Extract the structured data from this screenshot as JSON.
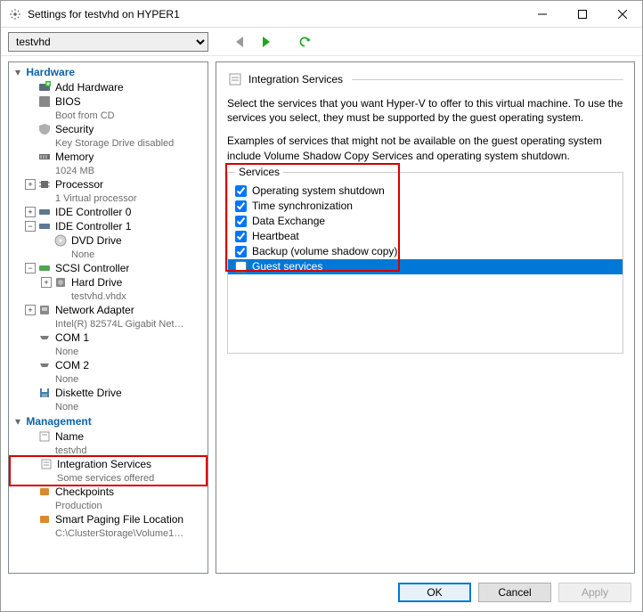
{
  "window": {
    "title": "Settings for testvhd on HYPER1",
    "vm_selector": "testvhd"
  },
  "tree": {
    "hardware_label": "Hardware",
    "management_label": "Management",
    "items": {
      "add_hw": "Add Hardware",
      "bios": "BIOS",
      "bios_sub": "Boot from CD",
      "security": "Security",
      "security_sub": "Key Storage Drive disabled",
      "memory": "Memory",
      "memory_sub": "1024 MB",
      "processor": "Processor",
      "processor_sub": "1 Virtual processor",
      "ide0": "IDE Controller 0",
      "ide1": "IDE Controller 1",
      "dvd": "DVD Drive",
      "dvd_sub": "None",
      "scsi": "SCSI Controller",
      "hdd": "Hard Drive",
      "hdd_sub": "testvhd.vhdx",
      "net": "Network Adapter",
      "net_sub": "Intel(R) 82574L Gigabit Networ...",
      "com1": "COM 1",
      "com1_sub": "None",
      "com2": "COM 2",
      "com2_sub": "None",
      "floppy": "Diskette Drive",
      "floppy_sub": "None",
      "name": "Name",
      "name_sub": "testvhd",
      "integ": "Integration Services",
      "integ_sub": "Some services offered",
      "chk": "Checkpoints",
      "chk_sub": "Production",
      "spf": "Smart Paging File Location",
      "spf_sub": "C:\\ClusterStorage\\Volume1\\Co..."
    }
  },
  "right": {
    "title": "Integration Services",
    "desc1": "Select the services that you want Hyper-V to offer to this virtual machine. To use the services you select, they must be supported by the guest operating system.",
    "desc2": "Examples of services that might not be available on the guest operating system include Volume Shadow Copy Services and operating system shutdown.",
    "group_label": "Services",
    "services": [
      {
        "label": "Operating system shutdown",
        "checked": true,
        "selected": false
      },
      {
        "label": "Time synchronization",
        "checked": true,
        "selected": false
      },
      {
        "label": "Data Exchange",
        "checked": true,
        "selected": false
      },
      {
        "label": "Heartbeat",
        "checked": true,
        "selected": false
      },
      {
        "label": "Backup (volume shadow copy)",
        "checked": true,
        "selected": false
      },
      {
        "label": "Guest services",
        "checked": false,
        "selected": true
      }
    ]
  },
  "buttons": {
    "ok": "OK",
    "cancel": "Cancel",
    "apply": "Apply"
  }
}
